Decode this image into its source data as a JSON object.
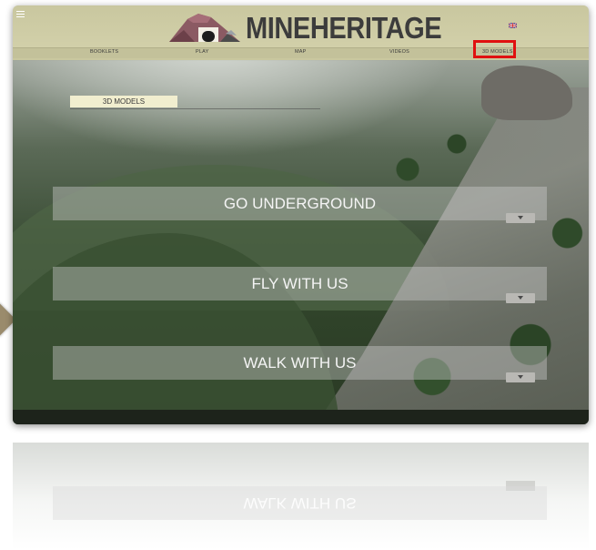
{
  "header": {
    "logo_text": "MINEHERITAGE",
    "menu_icon": "hamburger-menu-icon",
    "language_icon": "uk-flag-icon"
  },
  "nav": {
    "items": [
      {
        "label": "BOOKLETS"
      },
      {
        "label": "PLAY"
      },
      {
        "label": "MAP"
      },
      {
        "label": "VIDEOS"
      },
      {
        "label": "3D MODELS",
        "highlighted": true
      }
    ]
  },
  "main": {
    "section_label": "3D MODELS",
    "sections": [
      {
        "title": "GO UNDERGROUND",
        "expand_icon": "chevron-down-icon"
      },
      {
        "title": "FLY WITH US",
        "expand_icon": "chevron-down-icon"
      },
      {
        "title": "WALK WITH US",
        "expand_icon": "chevron-down-icon"
      }
    ]
  },
  "reflection": {
    "text": "WALK WITH US"
  },
  "colors": {
    "header_bg": "#d4d2ac",
    "highlight": "#e01010",
    "section_box": "rgba(205,205,205,0.42)"
  }
}
